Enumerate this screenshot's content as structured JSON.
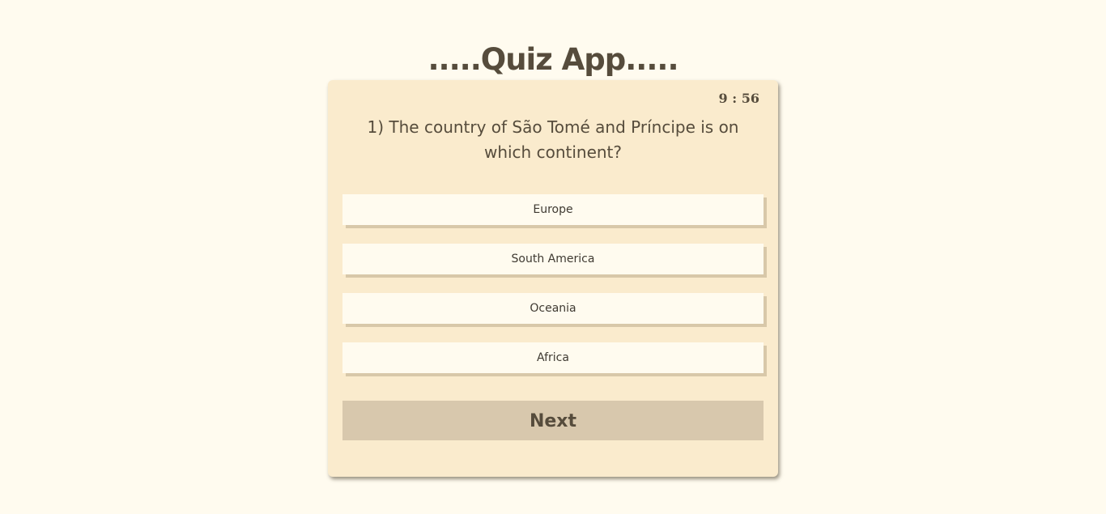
{
  "app": {
    "title": ".....Quiz App....."
  },
  "quiz": {
    "timer": "9 : 56",
    "question": "1) The country of São Tomé and Príncipe is on which continent?",
    "options": [
      "Europe",
      "South America",
      "Oceania",
      "Africa"
    ],
    "next_label": "Next"
  },
  "colors": {
    "page_background": "#fffbef",
    "card_background": "#faebcd",
    "option_background": "#fffbef",
    "option_shadow": "#d8c8a9",
    "next_button_background": "#d8c8ad",
    "text": "#564c3c"
  }
}
